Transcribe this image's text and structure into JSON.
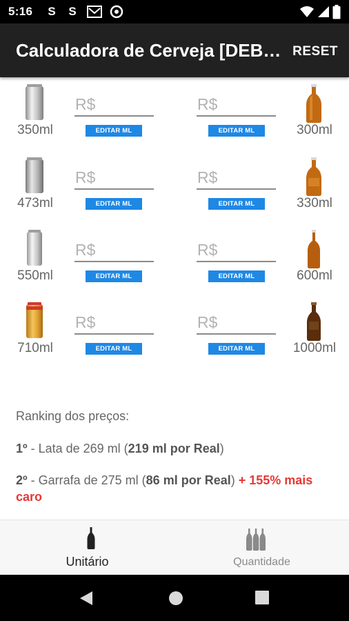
{
  "status_bar": {
    "time": "5:16",
    "notification_icons": [
      "s-app-icon",
      "s-app-icon",
      "gmail-icon",
      "vpn-icon"
    ],
    "system_icons": [
      "wifi-icon",
      "signal-icon",
      "battery-icon"
    ]
  },
  "app_bar": {
    "title": "Calculadora de Cerveja [DEB…",
    "reset_label": "RESET"
  },
  "rows": [
    {
      "left_size": "350ml",
      "right_size": "300ml",
      "price_placeholder": "R$",
      "edit_label": "EDITAR ML"
    },
    {
      "left_size": "473ml",
      "right_size": "330ml",
      "price_placeholder": "R$",
      "edit_label": "EDITAR ML"
    },
    {
      "left_size": "550ml",
      "right_size": "600ml",
      "price_placeholder": "R$",
      "edit_label": "EDITAR ML"
    },
    {
      "left_size": "710ml",
      "right_size": "1000ml",
      "price_placeholder": "R$",
      "edit_label": "EDITAR ML"
    }
  ],
  "ranking": {
    "heading": "Ranking dos preços:",
    "items": [
      {
        "position": "1º",
        "text": " - Lata de 269 ml (",
        "rate": "219 ml por Real",
        "close": ")",
        "extra": ""
      },
      {
        "position": "2º",
        "text": " - Garrafa de 275 ml (",
        "rate": "86 ml por Real",
        "close": ")",
        "extra": " + 155% mais caro"
      }
    ]
  },
  "bottom_nav": {
    "tabs": [
      {
        "label": "Unitário",
        "active": true
      },
      {
        "label": "Quantidade",
        "active": false
      }
    ]
  },
  "colors": {
    "app_bar": "#212121",
    "edit_button": "#1e88e5",
    "ranking_highlight": "#e53935",
    "can_silver": "#c8c8c8",
    "can_gold": "#e0a030",
    "bottle_amber": "#b8650f",
    "bottle_dark": "#5a2d0c"
  }
}
